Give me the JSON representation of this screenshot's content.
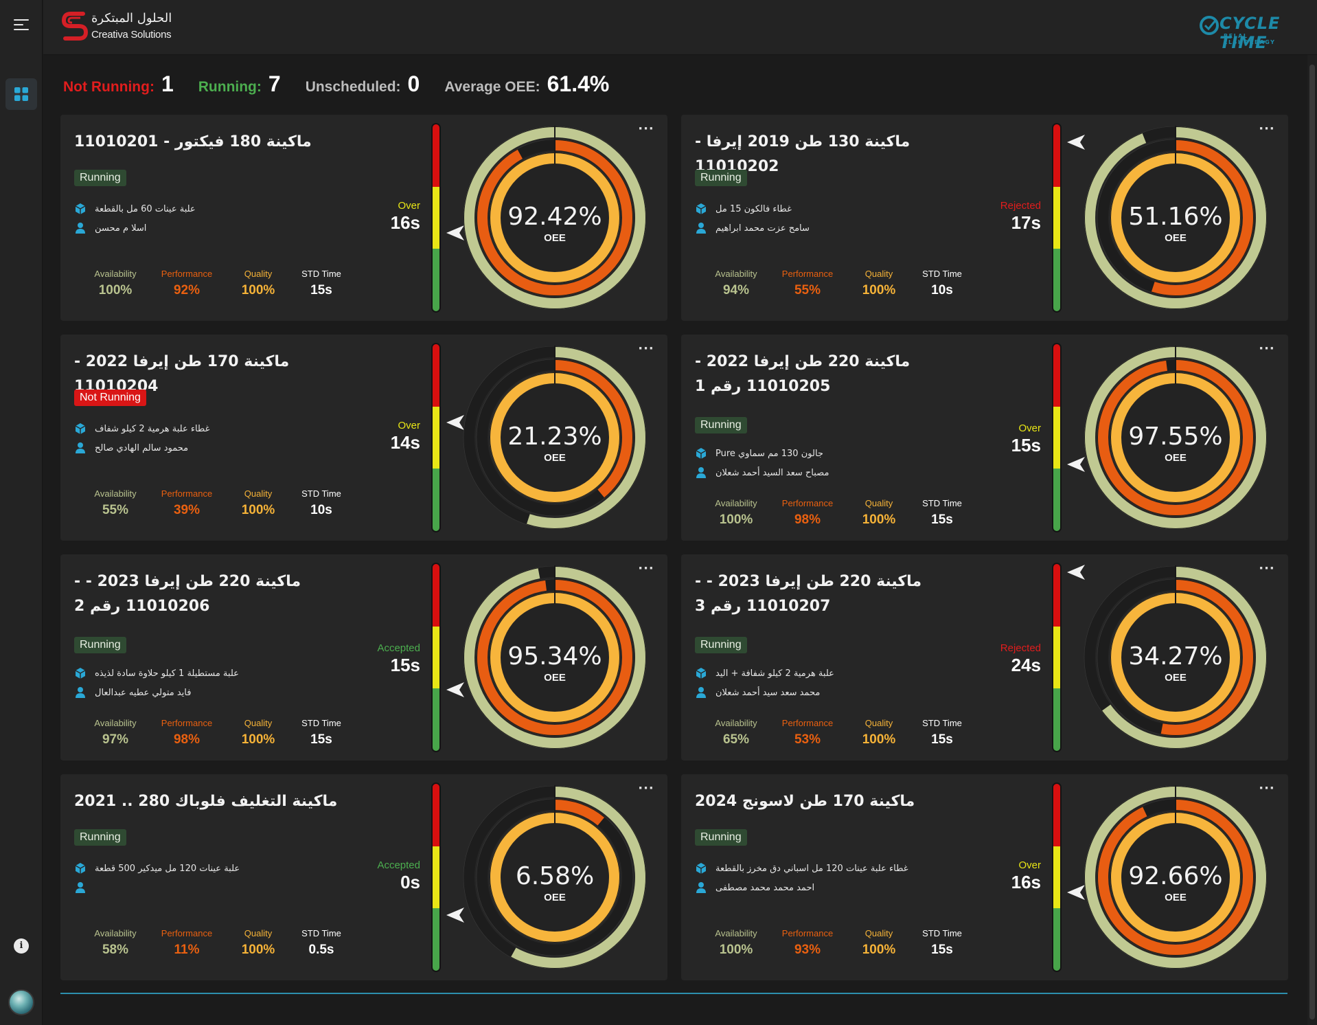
{
  "brand": {
    "arabic_name": "الحلول المبتكرة",
    "english_name": "Creativa Solutions",
    "product_name": "CYCLE TIME",
    "product_subtitle": "BELAL ELSHORBAGY"
  },
  "colors": {
    "not_running": "#e11d1d",
    "running": "#4cae4f",
    "unscheduled": "#bdbdbd",
    "availability": "#b9c38f",
    "performance": "#e96010",
    "quality": "#f6b338",
    "std": "#ffffff",
    "ring_availability": "#c0c992",
    "ring_performance": "#e85d12",
    "ring_quality": "#f7b53c",
    "track": "#1d1d1d",
    "accent_blue": "#2aa8d6"
  },
  "summary": {
    "not_running_label": "Not Running:",
    "not_running_value": "1",
    "running_label": "Running:",
    "running_value": "7",
    "unscheduled_label": "Unscheduled:",
    "unscheduled_value": "0",
    "average_oee_label": "Average OEE:",
    "average_oee_value": "61.4%"
  },
  "labels": {
    "availability": "Availability",
    "performance": "Performance",
    "quality": "Quality",
    "std_time": "STD Time",
    "oee": "OEE",
    "more": "···"
  },
  "machines": [
    {
      "title": "ماكينة 180 فيكتور - 11010201",
      "status": "Running",
      "product": "علبة عينات 60 مل بالقطعة",
      "operator": "اسلا م محسن",
      "availability": 100,
      "performance": 92,
      "quality": 100,
      "availability_text": "100%",
      "performance_text": "92%",
      "quality_text": "100%",
      "std_time": "15s",
      "oee_text": "92.42%",
      "cycle_label": "Over",
      "cycle_value": "16s",
      "gauge_level": 0.42
    },
    {
      "title": "ماكينة 130 طن 2019 إيرفا - 11010202",
      "status": "Running",
      "product": "غطاء فالكون 15 مل",
      "operator": "سامح عزت محمد ابراهيم",
      "availability": 94,
      "performance": 55,
      "quality": 100,
      "availability_text": "94%",
      "performance_text": "55%",
      "quality_text": "100%",
      "std_time": "10s",
      "oee_text": "51.16%",
      "cycle_label": "Rejected",
      "cycle_value": "17s",
      "gauge_level": 0.9
    },
    {
      "title": "ماكينة 170 طن إيرفا 2022 - 11010204",
      "status": "Not Running",
      "product": "غطاء علبة هرمية 2 كيلو شفاف",
      "operator": "محمود سالم الهادي صالح",
      "availability": 55,
      "performance": 39,
      "quality": 100,
      "availability_text": "55%",
      "performance_text": "39%",
      "quality_text": "100%",
      "std_time": "10s",
      "oee_text": "21.23%",
      "cycle_label": "Over",
      "cycle_value": "14s",
      "gauge_level": 0.58
    },
    {
      "title": "ماكينة 220 طن إيرفا 2022 - 11010205 رقم 1",
      "status": "Running",
      "product": "جالون 130 مم سماوي Pure",
      "operator": "مصباح سعد السيد أحمد شعلان",
      "availability": 100,
      "performance": 98,
      "quality": 100,
      "availability_text": "100%",
      "performance_text": "98%",
      "quality_text": "100%",
      "std_time": "15s",
      "oee_text": "97.55%",
      "cycle_label": "Over",
      "cycle_value": "15s",
      "gauge_level": 0.36
    },
    {
      "title": "ماكينة 220 طن إيرفا 2023 - - 11010206 رقم 2",
      "status": "Running",
      "product": "علبة مستطيلة 1 كيلو حلاوة سادة لذيذه",
      "operator": "فايد متولي عطيه عبدالعال",
      "availability": 97,
      "performance": 98,
      "quality": 100,
      "availability_text": "97%",
      "performance_text": "98%",
      "quality_text": "100%",
      "std_time": "15s",
      "oee_text": "95.34%",
      "cycle_label": "Accepted",
      "cycle_value": "15s",
      "gauge_level": 0.33
    },
    {
      "title": "ماكينة 220 طن إيرفا 2023 - - 11010207 رقم 3",
      "status": "Running",
      "product": "علبة هرمية 2 كيلو شفافة + اليد",
      "operator": "محمد سعد سيد أحمد شعلان",
      "availability": 65,
      "performance": 53,
      "quality": 100,
      "availability_text": "65%",
      "performance_text": "53%",
      "quality_text": "100%",
      "std_time": "15s",
      "oee_text": "34.27%",
      "cycle_label": "Rejected",
      "cycle_value": "24s",
      "gauge_level": 0.95
    },
    {
      "title": "ماكينة التغليف فلوباك 280 .. 2021",
      "status": "Running",
      "product": "علبة عينات 120 مل ميدكير 500 قطعة",
      "operator": "",
      "availability": 58,
      "performance": 11,
      "quality": 100,
      "availability_text": "58%",
      "performance_text": "11%",
      "quality_text": "100%",
      "std_time": "0.5s",
      "oee_text": "6.58%",
      "cycle_label": "Accepted",
      "cycle_value": "0s",
      "gauge_level": 0.3
    },
    {
      "title": "ماكينة 170 طن لاسونج 2024",
      "status": "Running",
      "product": "غطاء علبة عينات 120 مل اسباني دق مخرز بالقطعة",
      "operator": "احمد محمد محمد مصطفى",
      "availability": 100,
      "performance": 93,
      "quality": 100,
      "availability_text": "100%",
      "performance_text": "93%",
      "quality_text": "100%",
      "std_time": "15s",
      "oee_text": "92.66%",
      "cycle_label": "Over",
      "cycle_value": "16s",
      "gauge_level": 0.42
    }
  ]
}
